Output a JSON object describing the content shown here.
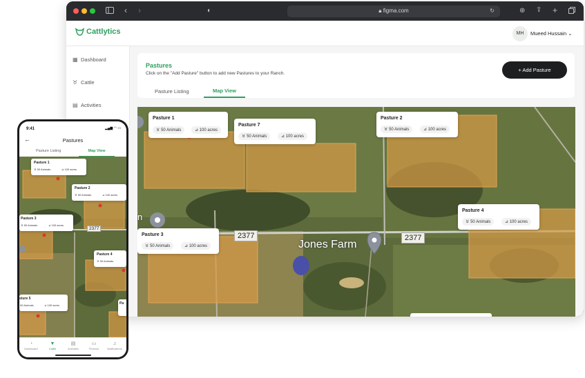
{
  "browser": {
    "url": "figma.com"
  },
  "app": {
    "brand": "Cattlytics",
    "user_initials": "MH",
    "user_name": "Mueed Hussain ⌄"
  },
  "sidebar": {
    "items": [
      {
        "label": "Dashboard",
        "icon": "grid-icon"
      },
      {
        "label": "Cattle",
        "icon": "cow-icon"
      },
      {
        "label": "Activities",
        "icon": "list-icon"
      }
    ]
  },
  "page": {
    "title": "Pastures",
    "subtitle": "Click on the \"Add Pasture\" button to add new Pastures to your Ranch.",
    "add_button": "+ Add Pasture",
    "tabs": [
      "Pasture Listing",
      "Map View"
    ]
  },
  "map": {
    "place_label": "Jones Farm",
    "road_labels": [
      "2377",
      "2377"
    ],
    "edge_letter": "n",
    "pastures": [
      {
        "name": "Pasture 1",
        "animals": "50 Animals",
        "acres": "100 acres"
      },
      {
        "name": "Pasture 7",
        "animals": "50 Animals",
        "acres": "100 acres"
      },
      {
        "name": "Pasture 2",
        "animals": "50 Animals",
        "acres": "100 acres"
      },
      {
        "name": "Pasture 4",
        "animals": "50 Animals",
        "acres": "100 acres"
      },
      {
        "name": "Pasture 3",
        "animals": "50 Animals",
        "acres": "100 acres"
      }
    ]
  },
  "phone": {
    "time": "9:41",
    "status": "▂▄▆ ◠ ▭",
    "title": "Pastures",
    "tabs": [
      "Pasture Listing",
      "Map View"
    ],
    "road_label": "2377",
    "pastures": [
      {
        "name": "Pasture 1",
        "animals": "50 Animals",
        "acres": "100 acres"
      },
      {
        "name": "Pasture 2",
        "animals": "50 Animals",
        "acres": "100 acres"
      },
      {
        "name": "Pasture 3",
        "animals": "50 Animals",
        "acres": "100 acres"
      },
      {
        "name": "Pasture 4",
        "animals": "50 Animals"
      },
      {
        "name": "sture 5",
        "animals": "50 Animals",
        "acres": "100 acres"
      },
      {
        "name": "Pa"
      }
    ],
    "nav": [
      "Dashboard",
      "Cattle",
      "Activities",
      "Finance",
      "Notifications"
    ]
  },
  "colors": {
    "brand_green": "#2f9e5f",
    "pasture_fill": "#d79a46",
    "pin_red": "#d63a2e"
  }
}
